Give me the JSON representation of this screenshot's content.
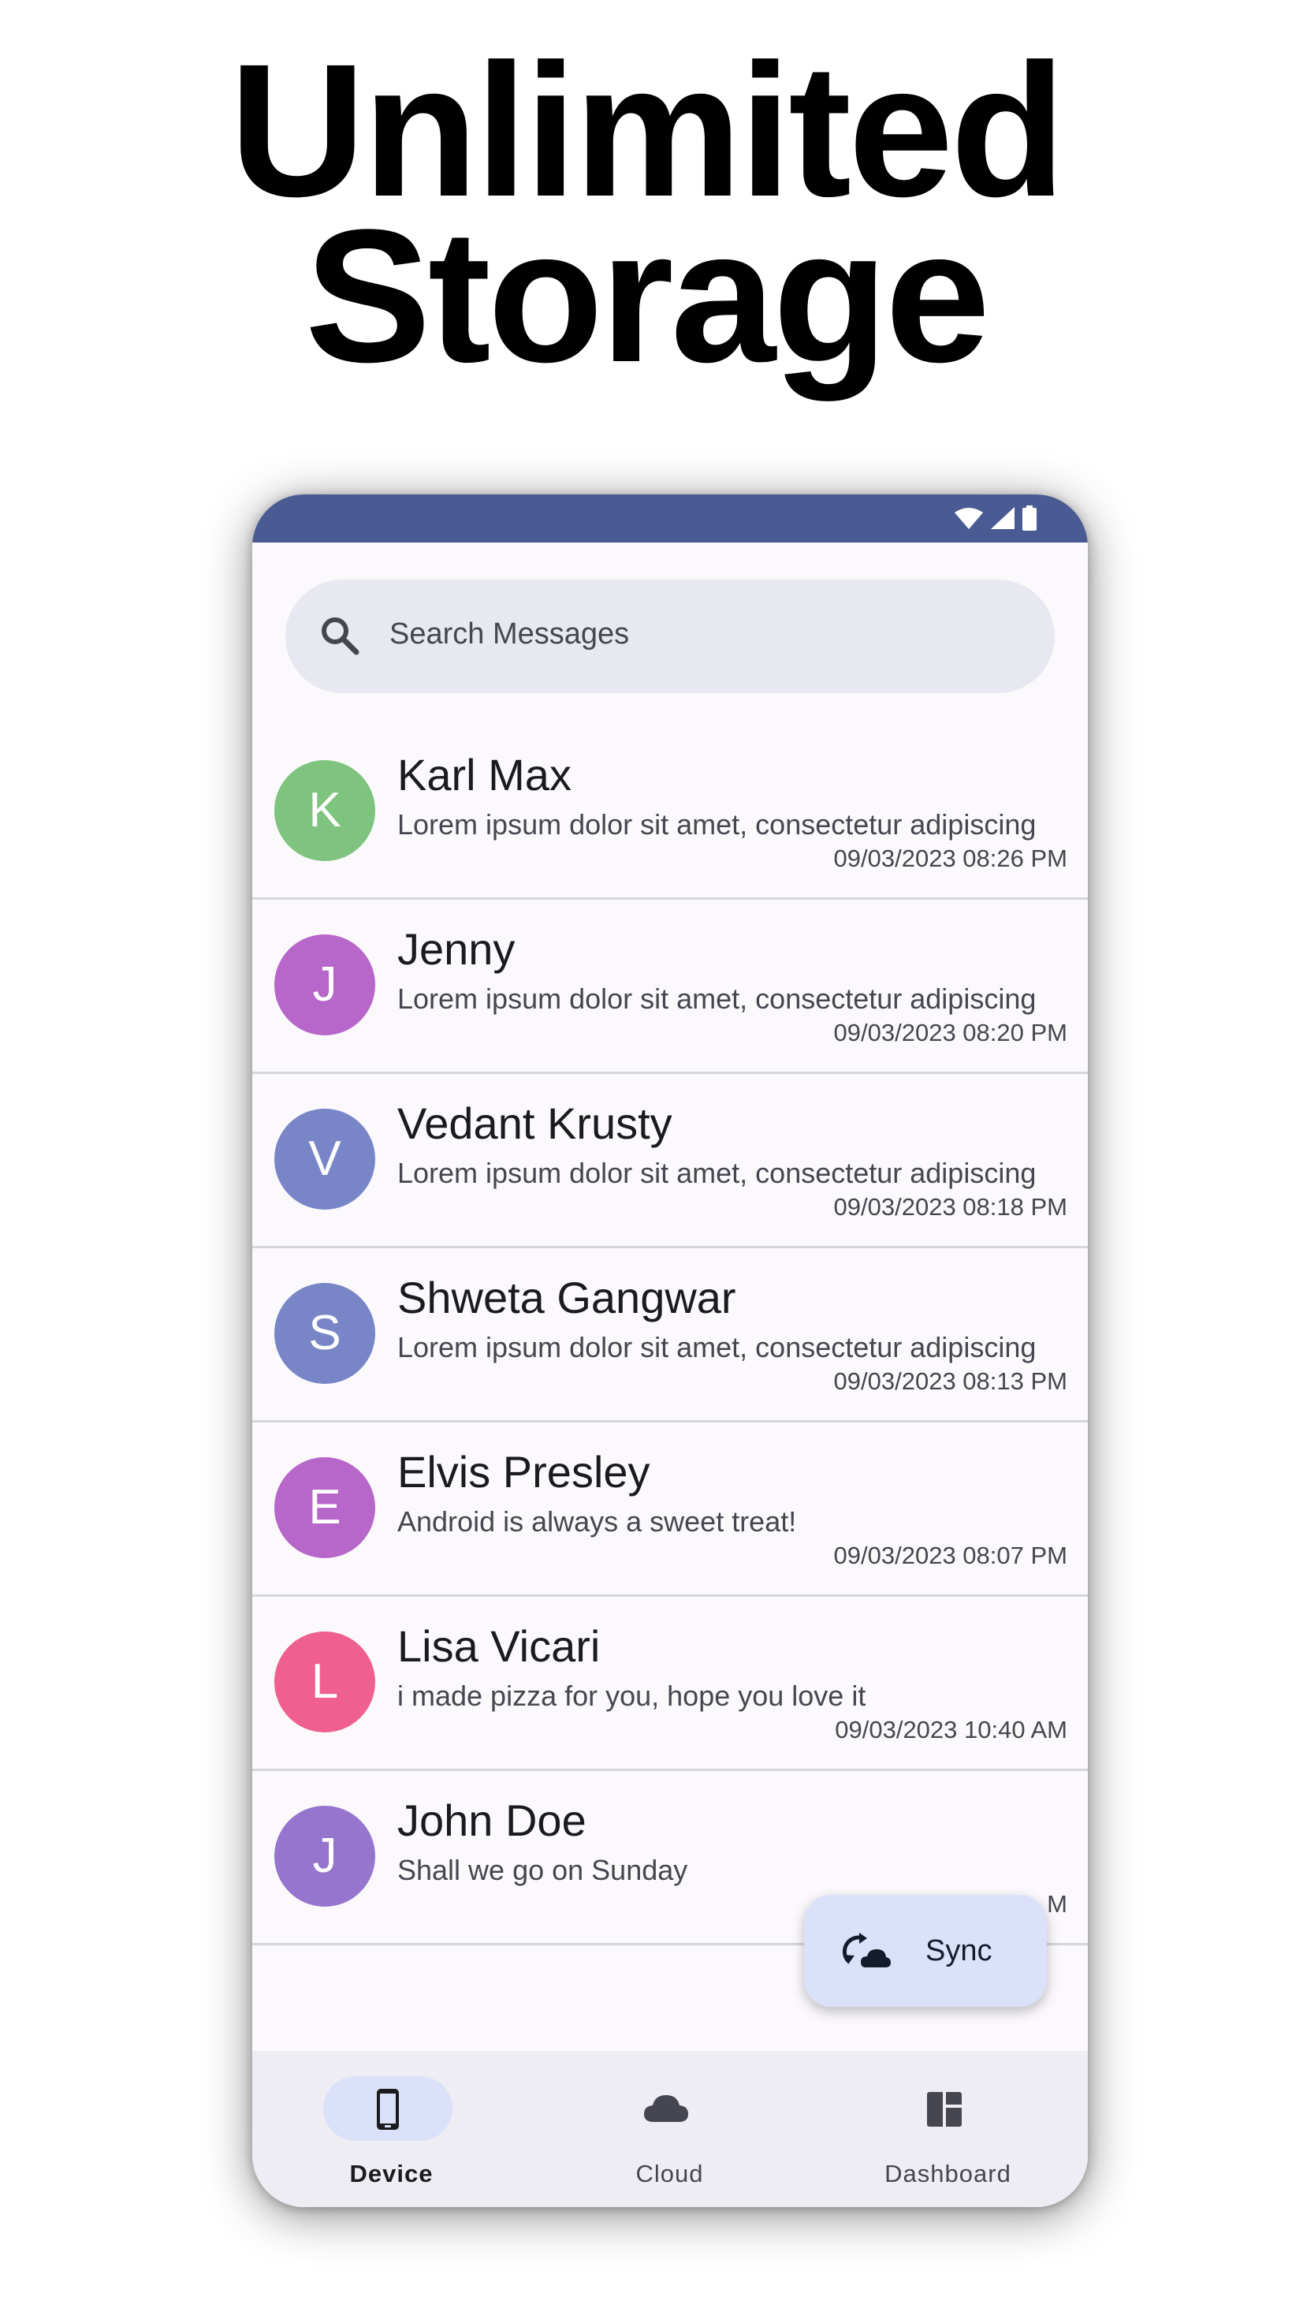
{
  "headline": {
    "line1": "Unlimited",
    "line2": "Storage"
  },
  "search": {
    "placeholder": "Search Messages",
    "icon": "search-icon"
  },
  "conversations": [
    {
      "initial": "K",
      "name": "Karl Max",
      "message": "Lorem ipsum dolor sit amet, consectetur adipiscing",
      "time": "09/03/2023 08:26 PM",
      "color": "#7ec47e"
    },
    {
      "initial": "J",
      "name": "Jenny",
      "message": "Lorem ipsum dolor sit amet, consectetur adipiscing",
      "time": "09/03/2023 08:20 PM",
      "color": "#b766c9"
    },
    {
      "initial": "V",
      "name": "Vedant Krusty",
      "message": "Lorem ipsum dolor sit amet, consectetur adipiscing",
      "time": "09/03/2023 08:18 PM",
      "color": "#7886c8"
    },
    {
      "initial": "S",
      "name": "Shweta Gangwar",
      "message": "Lorem ipsum dolor sit amet, consectetur adipiscing",
      "time": "09/03/2023 08:13 PM",
      "color": "#7886c8"
    },
    {
      "initial": "E",
      "name": "Elvis Presley",
      "message": "Android is always a sweet treat!",
      "time": "09/03/2023 08:07 PM",
      "color": "#b766c9"
    },
    {
      "initial": "L",
      "name": "Lisa Vicari",
      "message": "i made pizza for you, hope you love it",
      "time": "09/03/2023 10:40 AM",
      "color": "#ef6090"
    },
    {
      "initial": "J",
      "name": "John Doe",
      "message": "Shall we go on Sunday",
      "time": "…M",
      "color": "#9575cd"
    }
  ],
  "fab": {
    "label": "Sync",
    "icon": "cloud-sync-icon"
  },
  "nav": [
    {
      "label": "Device",
      "icon": "phone-icon",
      "active": true
    },
    {
      "label": "Cloud",
      "icon": "cloud-icon",
      "active": false
    },
    {
      "label": "Dashboard",
      "icon": "dashboard-icon",
      "active": false
    }
  ],
  "colors": {
    "status_bar": "#4a5b94",
    "search_bg": "#e7e8f0",
    "fab_bg": "#dce1fa",
    "nav_bg": "#eeedf4",
    "nav_active_pill": "#dbe1f8"
  }
}
